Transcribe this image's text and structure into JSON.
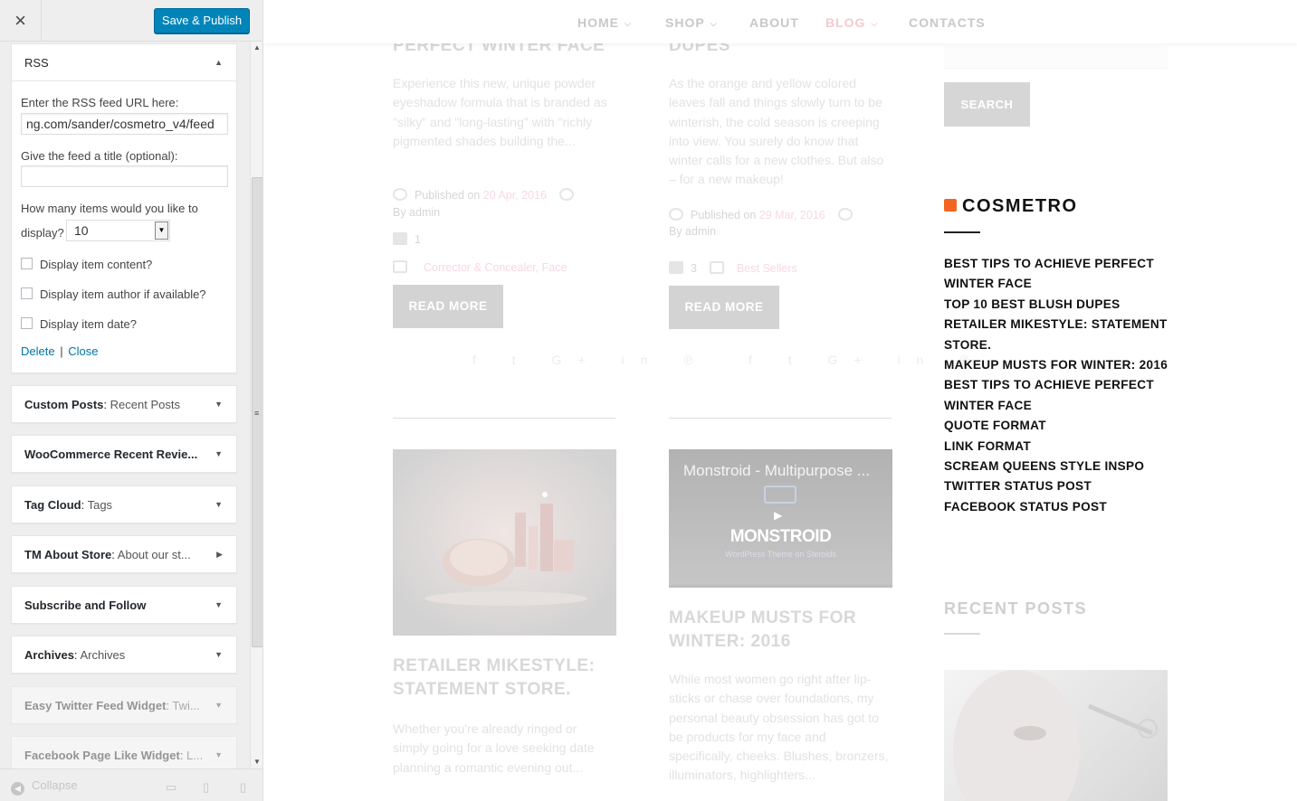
{
  "customizer": {
    "close_label": "×",
    "save_label": "Save & Publish",
    "rss_widget": {
      "title": "RSS",
      "url_label": "Enter the RSS feed URL here:",
      "url_value": "ng.com/sander/cosmetro_v4/feed",
      "title_label": "Give the feed a title (optional):",
      "title_value": "",
      "items_label_1": "How many items would you like to",
      "items_label_2": "display?",
      "items_value": "10",
      "opt_content": "Display item content?",
      "opt_author": "Display item author if available?",
      "opt_date": "Display item date?",
      "delete_label": "Delete",
      "sep": "|",
      "close_label": "Close"
    },
    "widgets": [
      {
        "name": "Custom Posts",
        "sub": "Recent Posts"
      },
      {
        "name": "WooCommerce Recent Revie...",
        "sub": ""
      },
      {
        "name": "Tag Cloud",
        "sub": "Tags"
      },
      {
        "name": "TM About Store",
        "sub": "About our st..."
      },
      {
        "name": "Subscribe and Follow",
        "sub": ""
      },
      {
        "name": "Archives",
        "sub": "Archives"
      },
      {
        "name": "Easy Twitter Feed Widget",
        "sub": "Twi..."
      },
      {
        "name": "Facebook Page Like Widget",
        "sub": "L..."
      }
    ],
    "collapse_label": "Collapse"
  },
  "preview": {
    "nav": [
      "HOME",
      "SHOP",
      "ABOUT",
      "BLOG",
      "CONTACTS"
    ],
    "post1": {
      "title": "PERFECT WINTER FACE",
      "excerpt": "Experience this new, unique powder eyeshadow formula that is branded as \"silky\" and \"long-lasting\" with \"richly pigmented shades building the...",
      "published": "Published on",
      "date": "20 Apr, 2016",
      "author": "By admin",
      "comments": "1",
      "categories": "Corrector & Concealer, Face",
      "read_more": "READ MORE"
    },
    "post2": {
      "title": "DUPES",
      "excerpt": "As the orange and yellow colored leaves fall and things slowly turn to be winterish, the cold season is creeping into view. You surely do know that winter calls for a new clothes. But also – for a new makeup!",
      "published": "Published on",
      "date": "29 Mar, 2016",
      "author": "By admin",
      "comments": "3",
      "categories": "Best Sellers",
      "read_more": "READ MORE"
    },
    "post3": {
      "title": "RETAILER MIKESTYLE: STATEMENT STORE.",
      "excerpt": "Whether you're already ringed or simply going for a love seeking date planning a romantic evening out..."
    },
    "post4": {
      "video_title": "Monstroid - Multipurpose ...",
      "brand": "MONSTROID",
      "tagline": "WordPress Theme on Steroids",
      "title": "MAKEUP MUSTS FOR WINTER: 2016",
      "excerpt": "While most women go right after lip-sticks or chase over foundations, my personal beauty obsession has got to be products for my face and specifically, cheeks. Blushes, bronzers, illuminators, highlighters..."
    },
    "search_label": "SEARCH",
    "rss_title": "COSMETRO",
    "rss_items": [
      "BEST TIPS TO ACHIEVE PERFECT WINTER FACE",
      "TOP 10 BEST BLUSH DUPES",
      "RETAILER MIKESTYLE: STATEMENT STORE.",
      "MAKEUP MUSTS FOR WINTER: 2016",
      "BEST TIPS TO ACHIEVE PERFECT WINTER FACE",
      "QUOTE FORMAT",
      "LINK FORMAT",
      "SCREAM QUEENS STYLE INSPO",
      "TWITTER STATUS POST",
      "FACEBOOK STATUS POST"
    ],
    "recent_title": "RECENT POSTS"
  }
}
